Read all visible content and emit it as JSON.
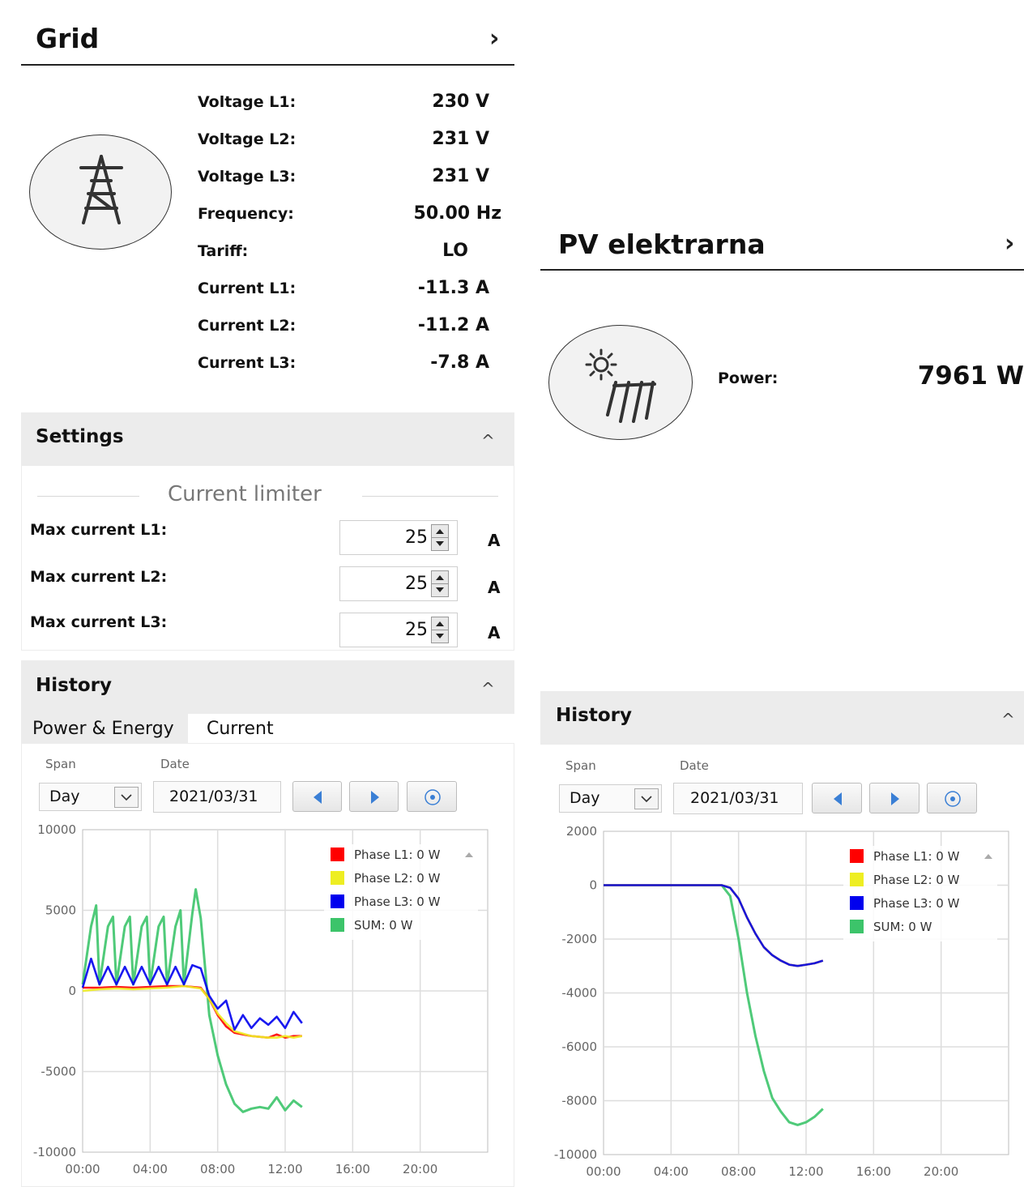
{
  "grid": {
    "title": "Grid",
    "chevron": "›",
    "icon": "power-pylon-icon",
    "measurements": [
      {
        "label": "Voltage L1:",
        "value": "230 V"
      },
      {
        "label": "Voltage L2:",
        "value": "231 V"
      },
      {
        "label": "Voltage L3:",
        "value": "231 V"
      },
      {
        "label": "Frequency:",
        "value": "50.00 Hz"
      },
      {
        "label": "Tariff:",
        "value": "LO"
      },
      {
        "label": "Current L1:",
        "value": "-11.3 A"
      },
      {
        "label": "Current L2:",
        "value": "-11.2 A"
      },
      {
        "label": "Current L3:",
        "value": "-7.8 A"
      }
    ],
    "settings": {
      "title": "Settings",
      "caret": "^",
      "subheading": "Current limiter",
      "limits": [
        {
          "label": "Max current L1:",
          "value": "25",
          "unit": "A"
        },
        {
          "label": "Max current L2:",
          "value": "25",
          "unit": "A"
        },
        {
          "label": "Max current L3:",
          "value": "25",
          "unit": "A"
        }
      ]
    },
    "history": {
      "title": "History",
      "caret": "^",
      "tabs": [
        "Power & Energy",
        "Current"
      ],
      "active_tab": "Power & Energy",
      "span_label": "Span",
      "date_label": "Date",
      "span_value": "Day",
      "date_value": "2021/03/31"
    }
  },
  "pv": {
    "title": "PV elektrarna",
    "chevron": "›",
    "icon": "solar-panel-icon",
    "power_label": "Power:",
    "power_value": "7961 W",
    "history": {
      "title": "History",
      "caret": "^",
      "span_label": "Span",
      "date_label": "Date",
      "span_value": "Day",
      "date_value": "2021/03/31"
    }
  },
  "colors": {
    "phase_l1": "#ff0000",
    "phase_l2": "#eeee22",
    "phase_l3": "#0000ee",
    "sum": "#3cc46a"
  },
  "chart_data": [
    {
      "type": "line",
      "x_ticks": [
        "00:00",
        "04:00",
        "08:00",
        "12:00",
        "16:00",
        "20:00"
      ],
      "y_ticks": [
        10000,
        5000,
        0,
        -5000,
        -10000
      ],
      "ylim": [
        -10000,
        10000
      ],
      "grid": true,
      "legend_position": "top-right",
      "legend": [
        "Phase L1: 0 W",
        "Phase L2: 0 W",
        "Phase L3: 0 W",
        "SUM: 0 W"
      ],
      "series": [
        {
          "name": "Phase L1",
          "x": [
            0,
            1,
            2,
            3,
            4,
            5,
            6,
            7,
            7.5,
            8,
            8.5,
            9,
            10,
            11,
            11.5,
            12,
            12.5,
            13
          ],
          "y": [
            200,
            200,
            250,
            200,
            250,
            300,
            300,
            200,
            -500,
            -1500,
            -2200,
            -2600,
            -2800,
            -2900,
            -2700,
            -2900,
            -2800,
            -2800
          ]
        },
        {
          "name": "Phase L2",
          "x": [
            0,
            1,
            2,
            3,
            4,
            5,
            6,
            7,
            7.5,
            8,
            8.5,
            9,
            10,
            11,
            11.5,
            12,
            12.5,
            13
          ],
          "y": [
            0,
            100,
            150,
            100,
            150,
            200,
            300,
            150,
            -500,
            -1400,
            -2000,
            -2500,
            -2800,
            -2900,
            -2900,
            -2800,
            -2900,
            -2800
          ]
        },
        {
          "name": "Phase L3",
          "x": [
            0,
            0.5,
            1,
            1.5,
            2,
            2.5,
            3,
            3.5,
            4,
            4.5,
            5,
            5.5,
            6,
            6.5,
            7,
            7.5,
            8,
            8.5,
            9,
            9.5,
            10,
            10.5,
            11,
            11.5,
            12,
            12.5,
            13
          ],
          "y": [
            200,
            2000,
            400,
            1500,
            400,
            1500,
            400,
            1500,
            400,
            1500,
            400,
            1500,
            400,
            1600,
            1400,
            -300,
            -1100,
            -600,
            -2400,
            -1500,
            -2300,
            -1700,
            -2100,
            -1600,
            -2300,
            -1300,
            -2000
          ]
        },
        {
          "name": "SUM",
          "x": [
            0,
            0.5,
            0.8,
            1,
            1.5,
            1.8,
            2,
            2.5,
            2.8,
            3,
            3.5,
            3.8,
            4,
            4.5,
            4.8,
            5,
            5.5,
            5.8,
            6,
            6.5,
            6.7,
            7,
            7.5,
            8,
            8.5,
            9,
            9.5,
            10,
            10.5,
            11,
            11.5,
            12,
            12.5,
            13
          ],
          "y": [
            400,
            4000,
            5300,
            400,
            4000,
            4600,
            400,
            4000,
            4600,
            400,
            4000,
            4600,
            400,
            4000,
            4600,
            400,
            4000,
            5000,
            400,
            4800,
            6300,
            4500,
            -1500,
            -4000,
            -5800,
            -7000,
            -7500,
            -7300,
            -7200,
            -7300,
            -6600,
            -7400,
            -6800,
            -7200
          ]
        }
      ]
    },
    {
      "type": "line",
      "x_ticks": [
        "00:00",
        "04:00",
        "08:00",
        "12:00",
        "16:00",
        "20:00"
      ],
      "y_ticks": [
        2000,
        0,
        -2000,
        -4000,
        -6000,
        -8000,
        -10000
      ],
      "ylim": [
        -10000,
        2000
      ],
      "grid": true,
      "legend_position": "top-right",
      "legend": [
        "Phase L1: 0 W",
        "Phase L2: 0 W",
        "Phase L3: 0 W",
        "SUM: 0 W"
      ],
      "series": [
        {
          "name": "Phase L1",
          "x": [
            0,
            3,
            6,
            7,
            7.5,
            8,
            8.5,
            9,
            9.5,
            10,
            10.5,
            11,
            11.5,
            12,
            12.5,
            13
          ],
          "y": [
            0,
            0,
            0,
            0,
            -100,
            -500,
            -1200,
            -1800,
            -2300,
            -2600,
            -2800,
            -2950,
            -3000,
            -2950,
            -2900,
            -2800
          ]
        },
        {
          "name": "Phase L2",
          "x": [
            0,
            3,
            6,
            7,
            7.5,
            8,
            8.5,
            9,
            9.5,
            10,
            10.5,
            11,
            11.5,
            12,
            12.5,
            13
          ],
          "y": [
            0,
            0,
            0,
            0,
            -100,
            -500,
            -1200,
            -1800,
            -2300,
            -2600,
            -2800,
            -2950,
            -3000,
            -2950,
            -2900,
            -2800
          ]
        },
        {
          "name": "Phase L3",
          "x": [
            0,
            3,
            6,
            7,
            7.5,
            8,
            8.5,
            9,
            9.5,
            10,
            10.5,
            11,
            11.5,
            12,
            12.5,
            13
          ],
          "y": [
            0,
            0,
            0,
            0,
            -100,
            -500,
            -1200,
            -1800,
            -2300,
            -2600,
            -2800,
            -2950,
            -3000,
            -2950,
            -2900,
            -2800
          ]
        },
        {
          "name": "SUM",
          "x": [
            0,
            3,
            6,
            7,
            7.5,
            8,
            8.5,
            9,
            9.5,
            10,
            10.5,
            11,
            11.5,
            12,
            12.5,
            13
          ],
          "y": [
            0,
            0,
            0,
            0,
            -400,
            -2000,
            -4000,
            -5600,
            -6900,
            -7900,
            -8400,
            -8800,
            -8900,
            -8800,
            -8600,
            -8300
          ]
        }
      ]
    }
  ]
}
